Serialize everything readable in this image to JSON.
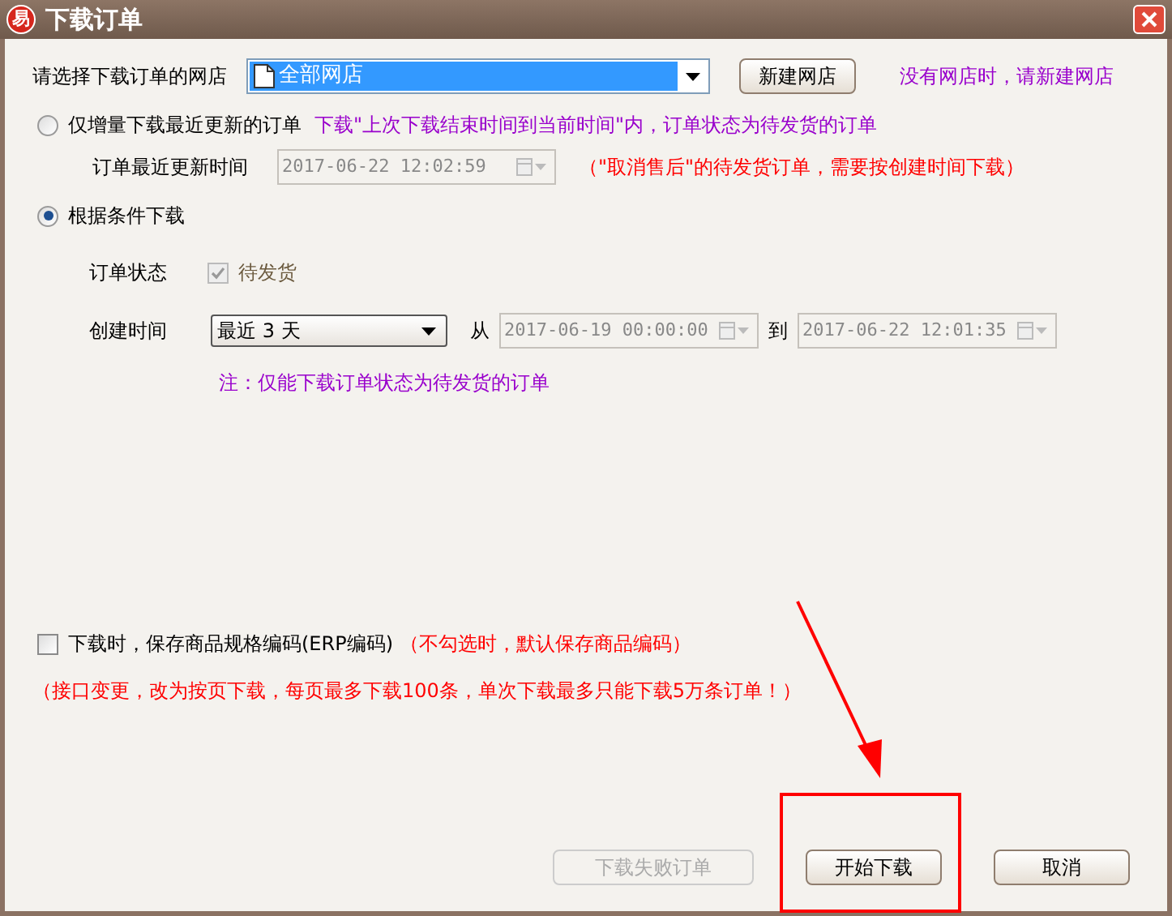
{
  "window": {
    "title": "下载订单",
    "app_badge": "易"
  },
  "store": {
    "label": "请选择下载订单的网店",
    "value": "全部网店",
    "button": "新建网店",
    "hint": "没有网店时，请新建网店"
  },
  "modes": [
    {
      "label": "仅增量下载最近更新的订单",
      "selected": false,
      "note": "下载\"上次下载结束时间到当前时间\"内，订单状态为待发货的订单"
    },
    {
      "label": "根据条件下载",
      "selected": true
    }
  ],
  "update_time": {
    "label": "订单最近更新时间",
    "value": "2017-06-22 12:02:59",
    "disabled": true,
    "note": "（\"取消售后\"的待发货订单，需要按创建时间下载）"
  },
  "order_status": {
    "label": "订单状态",
    "option": "待发货",
    "checked": true,
    "disabled": true
  },
  "create_time": {
    "label": "创建时间",
    "range": "最近 3 天",
    "from_label": "从",
    "from": "2017-06-19 00:00:00",
    "to_label": "到",
    "to": "2017-06-22 12:01:35"
  },
  "condition_note": "注：仅能下载订单状态为待发货的订单",
  "save_sku": {
    "label": "下载时，保存商品规格编码(ERP编码)",
    "checked": false,
    "note": "（不勾选时，默认保存商品编码）"
  },
  "api_notice": "（接口变更，改为按页下载，每页最多下载100条，单次下载最多只能下载5万条订单！）",
  "buttons": [
    {
      "label": "下载失败订单",
      "disabled": true
    },
    {
      "label": "开始下载",
      "disabled": false
    },
    {
      "label": "取消",
      "disabled": false
    }
  ]
}
